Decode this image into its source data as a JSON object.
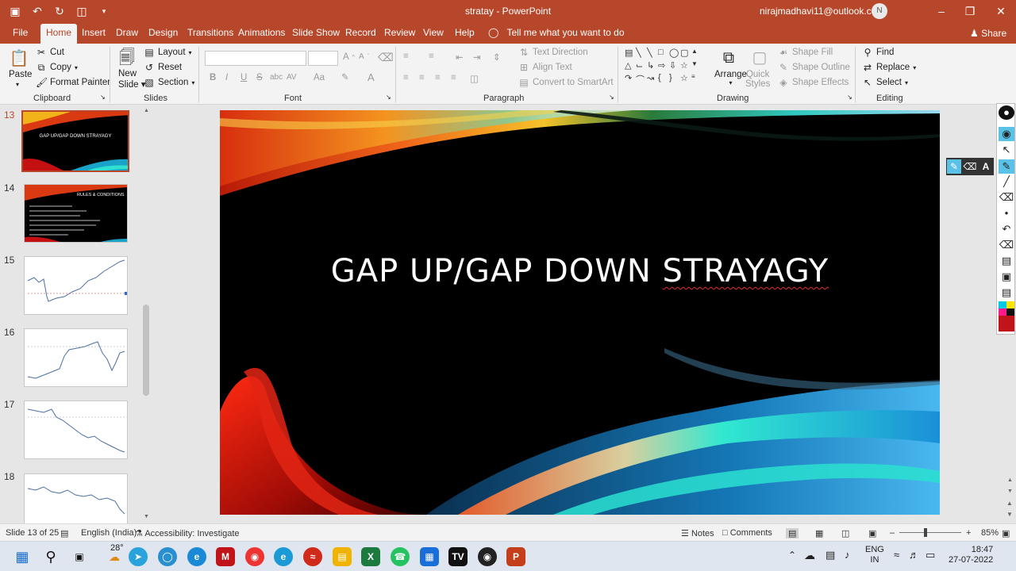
{
  "window": {
    "doc_name": "stratay",
    "app_name": "PowerPoint",
    "title_separator": " - ",
    "account": "nirajmadhavi11@outlook.com",
    "avatar_initial": "N"
  },
  "tabs": [
    "File",
    "Home",
    "Insert",
    "Draw",
    "Design",
    "Transitions",
    "Animations",
    "Slide Show",
    "Record",
    "Review",
    "View",
    "Help"
  ],
  "active_tab": "Home",
  "tell_me": "Tell me what you want to do",
  "share_label": "Share",
  "ribbon": {
    "clipboard": {
      "paste": "Paste",
      "cut": "Cut",
      "copy": "Copy",
      "format_painter": "Format Painter",
      "label": "Clipboard"
    },
    "slides": {
      "new_slide_1": "New",
      "new_slide_2": "Slide",
      "layout": "Layout",
      "reset": "Reset",
      "section": "Section",
      "label": "Slides"
    },
    "font": {
      "label": "Font",
      "bold": "B",
      "italic": "I",
      "underline": "U",
      "strike": "S",
      "shadow": "abc",
      "spacing": "AV",
      "case": "Aa",
      "grow": "A",
      "shrink": "A"
    },
    "paragraph": {
      "text_direction": "Text Direction",
      "align_text": "Align Text",
      "convert_smartart": "Convert to SmartArt",
      "label": "Paragraph"
    },
    "drawing": {
      "arrange": "Arrange",
      "quick_styles_1": "Quick",
      "quick_styles_2": "Styles",
      "shape_fill": "Shape Fill",
      "shape_outline": "Shape Outline",
      "shape_effects": "Shape Effects",
      "label": "Drawing"
    },
    "editing": {
      "find": "Find",
      "replace": "Replace",
      "select": "Select",
      "label": "Editing"
    }
  },
  "thumbnails": [
    {
      "number": "13",
      "text": "GAP UP/GAP DOWN STRAYAGY",
      "selected": true
    },
    {
      "number": "14",
      "text": "RULES & CONDITIONS",
      "selected": false
    },
    {
      "number": "15",
      "text": "",
      "selected": false
    },
    {
      "number": "16",
      "text": "",
      "selected": false
    },
    {
      "number": "17",
      "text": "",
      "selected": false
    },
    {
      "number": "18",
      "text": "",
      "selected": false
    }
  ],
  "slide": {
    "title_plain": "GAP UP/GAP DOWN ",
    "title_misspelled": "STRAYAGY"
  },
  "status": {
    "slide_info": "Slide 13 of 25",
    "language": "English (India)",
    "accessibility": "Accessibility: Investigate",
    "notes": "Notes",
    "comments": "Comments",
    "zoom": "85%"
  },
  "taskbar": {
    "weather": "28°",
    "lang_1": "ENG",
    "lang_2": "IN",
    "time": "18:47",
    "date": "27-07-2022"
  },
  "colors": {
    "accent": "#b7472a",
    "pen_active": "#5bc2e7"
  }
}
